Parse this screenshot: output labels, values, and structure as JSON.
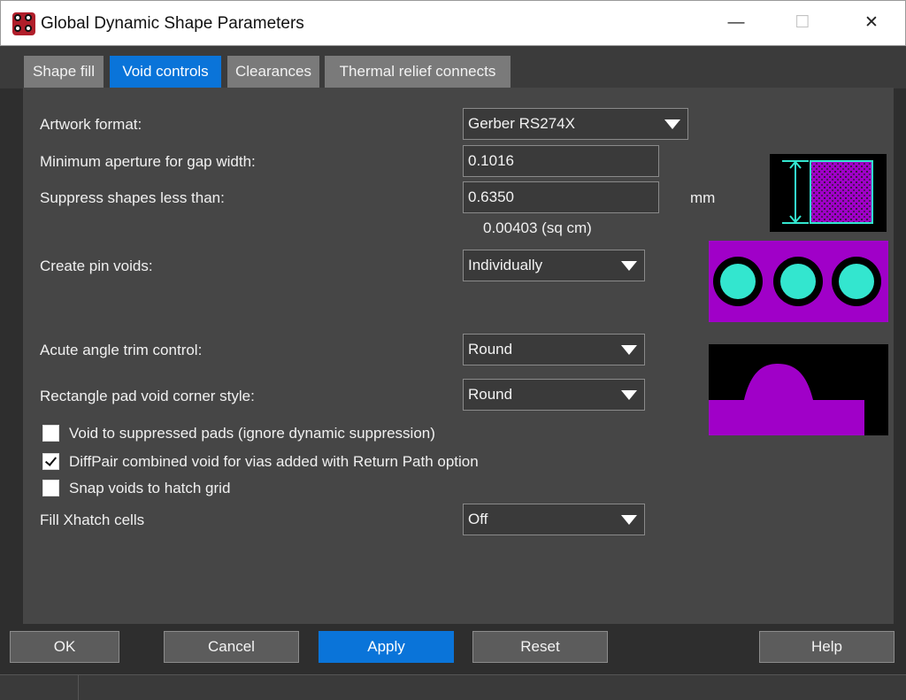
{
  "window": {
    "title": "Global Dynamic Shape Parameters",
    "minimize": "—",
    "maximize": "☐",
    "close": "✕"
  },
  "tabs": [
    {
      "label": "Shape fill",
      "active": false
    },
    {
      "label": "Void controls",
      "active": true
    },
    {
      "label": "Clearances",
      "active": false
    },
    {
      "label": "Thermal relief connects",
      "active": false
    }
  ],
  "form": {
    "artwork_format": {
      "label": "Artwork format:",
      "value": "Gerber RS274X"
    },
    "min_aperture": {
      "label": "Minimum aperture for gap width:",
      "value": "0.1016"
    },
    "suppress_shapes": {
      "label": "Suppress shapes less than:",
      "value": "0.6350",
      "unit": "mm",
      "area_note": "0.00403 (sq cm)"
    },
    "pin_voids": {
      "label": "Create pin voids:",
      "value": "Individually"
    },
    "acute_angle": {
      "label": "Acute angle trim control:",
      "value": "Round"
    },
    "rect_pad_corner": {
      "label": "Rectangle pad void corner style:",
      "value": "Round"
    },
    "checkboxes": [
      {
        "label": "Void to suppressed pads (ignore dynamic suppression)",
        "checked": false
      },
      {
        "label": "DiffPair combined void for vias added with Return Path option",
        "checked": true
      },
      {
        "label": "Snap voids to hatch grid",
        "checked": false
      }
    ],
    "fill_xhatch": {
      "label": "Fill Xhatch cells",
      "value": "Off"
    }
  },
  "buttons": {
    "ok": "OK",
    "cancel": "Cancel",
    "apply": "Apply",
    "reset": "Reset",
    "help": "Help"
  },
  "colors": {
    "accent": "#0a74d9",
    "magenta": "#a000c8",
    "cyan": "#33e6cf",
    "panel": "#464646"
  }
}
